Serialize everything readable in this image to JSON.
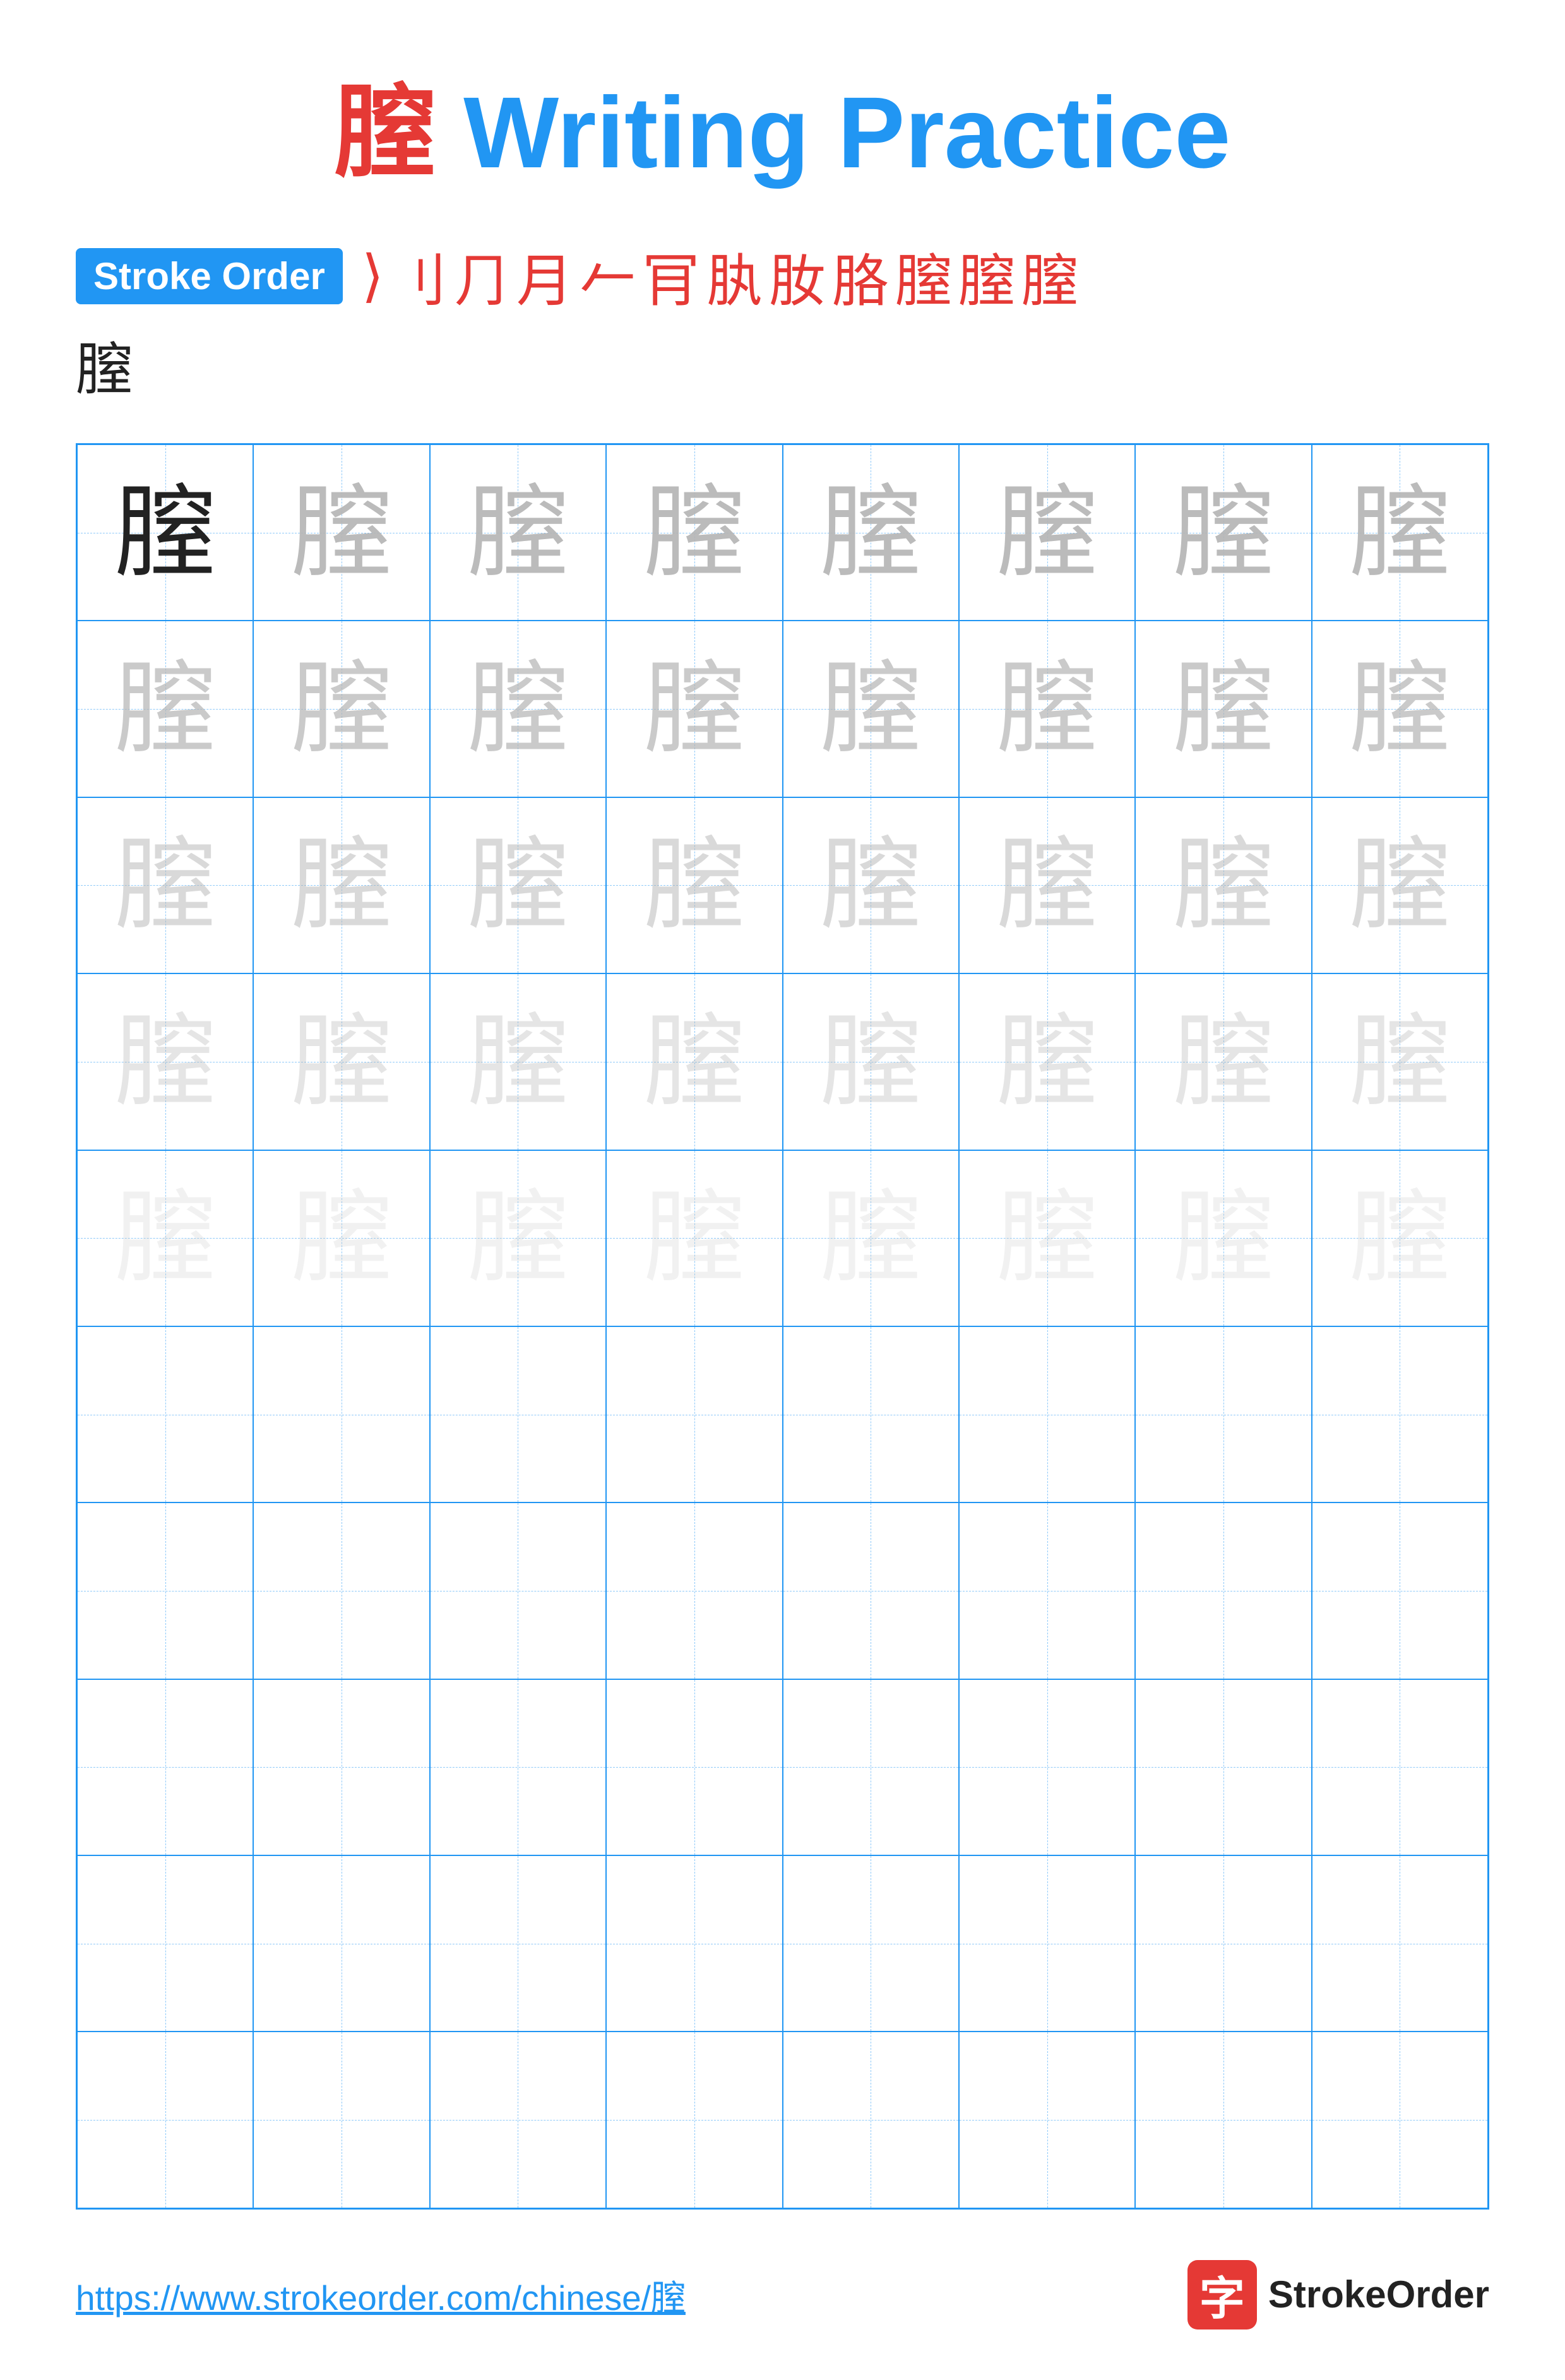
{
  "title": {
    "char": "膣",
    "suffix": " Writing Practice"
  },
  "stroke_order": {
    "badge": "Stroke Order",
    "strokes": [
      "⟩",
      "𠃊",
      "⺆",
      "月",
      "𦠿",
      "𦡀",
      "𦡁",
      "𦡂",
      "𦡃",
      "膣̶",
      "膣"
    ]
  },
  "character": "膣",
  "grid": {
    "rows": 10,
    "cols": 8,
    "practice_rows": [
      {
        "opacity": "dark",
        "count": 8
      },
      {
        "opacity": "1",
        "count": 8
      },
      {
        "opacity": "2",
        "count": 8
      },
      {
        "opacity": "3",
        "count": 8
      },
      {
        "opacity": "4",
        "count": 8
      },
      {
        "opacity": "empty",
        "count": 8
      },
      {
        "opacity": "empty",
        "count": 8
      },
      {
        "opacity": "empty",
        "count": 8
      },
      {
        "opacity": "empty",
        "count": 8
      },
      {
        "opacity": "empty",
        "count": 8
      }
    ]
  },
  "footer": {
    "url": "https://www.strokeorder.com/chinese/膣",
    "brand": "StrokeOrder",
    "brand_char": "字"
  }
}
